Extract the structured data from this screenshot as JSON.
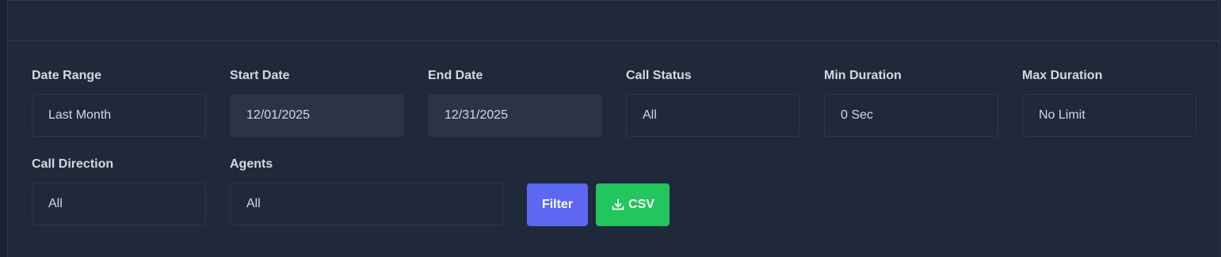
{
  "filters": {
    "date_range": {
      "label": "Date Range",
      "value": "Last Month"
    },
    "start_date": {
      "label": "Start Date",
      "value": "12/01/2025"
    },
    "end_date": {
      "label": "End Date",
      "value": "12/31/2025"
    },
    "call_status": {
      "label": "Call Status",
      "value": "All"
    },
    "min_duration": {
      "label": "Min Duration",
      "value": "0 Sec"
    },
    "max_duration": {
      "label": "Max Duration",
      "value": "No Limit"
    },
    "call_direction": {
      "label": "Call Direction",
      "value": "All"
    },
    "agents": {
      "label": "Agents",
      "value": "All"
    }
  },
  "actions": {
    "filter_label": "Filter",
    "csv_label": "CSV",
    "csv_icon": "download-icon"
  },
  "colors": {
    "filter_button": "#5c67f2",
    "csv_button": "#22c55e",
    "panel_background": "#1f293a"
  }
}
